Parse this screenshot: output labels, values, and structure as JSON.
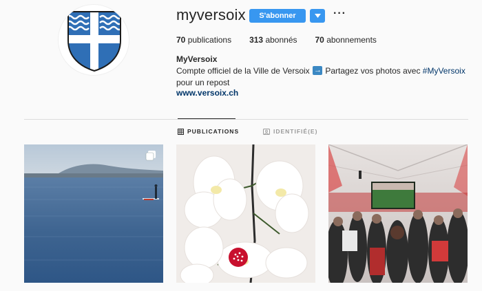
{
  "profile": {
    "username": "myversoix",
    "follow_label": "S'abonner",
    "more_label": "···",
    "stats": {
      "posts_count": "70",
      "posts_label": "publications",
      "followers_count": "313",
      "followers_label": "abonnés",
      "following_count": "70",
      "following_label": "abonnements"
    },
    "full_name": "MyVersoix",
    "bio_part1": "Compte officiel de la Ville de Versoix",
    "bio_part2": "Partagez vos photos avec",
    "bio_hashtag": "#MyVersoix",
    "bio_part3": "pour un repost",
    "website": "www.versoix.ch"
  },
  "tabs": [
    {
      "label": "PUBLICATIONS",
      "active": true
    },
    {
      "label": "IDENTIFIÉ(E)",
      "active": false
    }
  ],
  "posts": [
    {
      "subject": "lake-paddleboarder",
      "multi_image": true
    },
    {
      "subject": "white-orchids",
      "multi_image": false
    },
    {
      "subject": "tent-screening-crowd",
      "multi_image": false
    }
  ],
  "colors": {
    "accent": "#3897f0",
    "link": "#003569",
    "shield_blue": "#2f6fb6",
    "background": "#fafafa"
  }
}
